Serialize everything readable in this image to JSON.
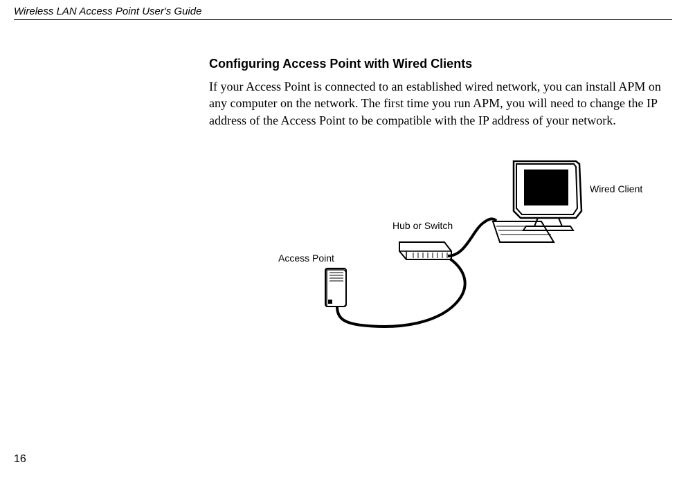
{
  "header": {
    "doc_title": "Wireless LAN Access Point User's Guide"
  },
  "section": {
    "title": "Configuring Access Point with Wired Clients",
    "body": "If your Access Point is connected to an established wired network, you can install APM on any computer on the network. The first time you run APM, you will need to change the IP address of the Access Point to be compatible with the IP address of your network."
  },
  "diagram": {
    "labels": {
      "access_point": "Access Point",
      "hub_switch": "Hub or Switch",
      "wired_client": "Wired Client"
    }
  },
  "page_number": "16"
}
